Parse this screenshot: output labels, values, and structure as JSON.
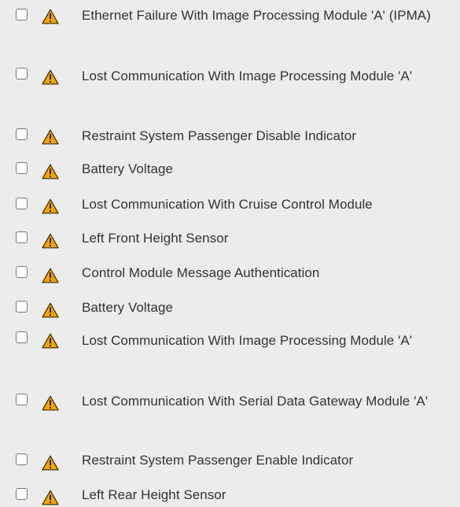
{
  "colors": {
    "background": "#ececec",
    "text": "#333333",
    "checkbox_border": "#767676",
    "warning_fill": "#f0a500",
    "warning_stroke": "#3a2a00"
  },
  "icons": {
    "checkbox": "checkbox-icon",
    "warning": "warning-triangle-icon"
  },
  "dtc_items": [
    {
      "label": "Ethernet Failure With Image Processing Module 'A' (IPMA)",
      "checked": false
    },
    {
      "label": "Lost Communication With Image Processing Module 'A'",
      "checked": false
    },
    {
      "label": "Restraint System Passenger Disable Indicator",
      "checked": false
    },
    {
      "label": "Battery Voltage",
      "checked": false
    },
    {
      "label": "Lost Communication With Cruise Control Module",
      "checked": false
    },
    {
      "label": "Left Front Height Sensor",
      "checked": false
    },
    {
      "label": "Control Module Message Authentication",
      "checked": false
    },
    {
      "label": "Battery Voltage",
      "checked": false
    },
    {
      "label": "Lost Communication With Image Processing Module 'A'",
      "checked": false
    },
    {
      "label": "Lost Communication With Serial Data Gateway Module 'A'",
      "checked": false
    },
    {
      "label": "Restraint System Passenger Enable Indicator",
      "checked": false
    },
    {
      "label": "Left Rear Height Sensor",
      "checked": false
    }
  ]
}
